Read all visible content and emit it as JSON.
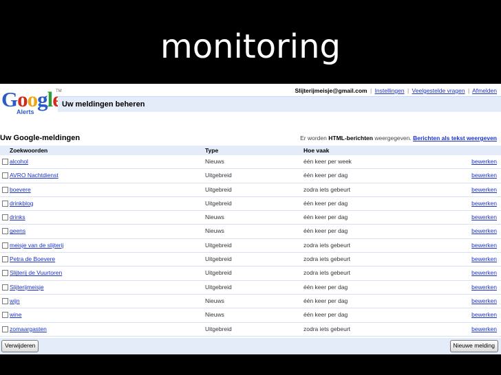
{
  "slide": {
    "title": "monitoring"
  },
  "logo": {
    "letters": [
      "G",
      "o",
      "o",
      "g",
      "l",
      "e"
    ],
    "sub": "Alerts",
    "tm": "TM"
  },
  "usernav": {
    "email": "Slijterijmeisje@gmail.com",
    "links": [
      "Instellingen",
      "Veelgestelde vragen",
      "Afmelden"
    ]
  },
  "header": {
    "title": "Uw meldingen beheren"
  },
  "section": {
    "title": "Uw Google-meldingen",
    "note_prefix": "Er worden",
    "note_bold": "HTML-berichten",
    "note_suffix": "weergegeven.",
    "note_link": "Berichten als tekst weergeven"
  },
  "table": {
    "headers": {
      "keywords": "Zoekwoorden",
      "type": "Type",
      "frequency": "Hoe vaak"
    },
    "rows": [
      {
        "name": "alcohol",
        "type": "Nieuws",
        "freq": "één keer per week",
        "edit": "bewerken"
      },
      {
        "name": "AVRO Nachtdienst",
        "type": "Uitgebreid",
        "freq": "één keer per dag",
        "edit": "bewerken"
      },
      {
        "name": "boevere",
        "type": "Uitgebreid",
        "freq": "zodra iets gebeurt",
        "edit": "bewerken"
      },
      {
        "name": "drinkblog",
        "type": "Uitgebreid",
        "freq": "één keer per dag",
        "edit": "bewerken"
      },
      {
        "name": "drinks",
        "type": "Nieuws",
        "freq": "één keer per dag",
        "edit": "bewerken"
      },
      {
        "name": "geens",
        "type": "Nieuws",
        "freq": "één keer per dag",
        "edit": "bewerken"
      },
      {
        "name": "meisje van de slijterij",
        "type": "Uitgebreid",
        "freq": "zodra iets gebeurt",
        "edit": "bewerken"
      },
      {
        "name": "Petra de Boevere",
        "type": "Uitgebreid",
        "freq": "zodra iets gebeurt",
        "edit": "bewerken"
      },
      {
        "name": "Slijterij de Vuurtoren",
        "type": "Uitgebreid",
        "freq": "zodra iets gebeurt",
        "edit": "bewerken"
      },
      {
        "name": "Slijterijmeisje",
        "type": "Uitgebreid",
        "freq": "één keer per dag",
        "edit": "bewerken"
      },
      {
        "name": "wijn",
        "type": "Nieuws",
        "freq": "één keer per dag",
        "edit": "bewerken"
      },
      {
        "name": "wine",
        "type": "Nieuws",
        "freq": "één keer per dag",
        "edit": "bewerken"
      },
      {
        "name": "zomaargasten",
        "type": "Uitgebreid",
        "freq": "zodra iets gebeurt",
        "edit": "bewerken"
      }
    ]
  },
  "buttons": {
    "delete": "Verwijderen",
    "new": "Nieuwe melding"
  }
}
